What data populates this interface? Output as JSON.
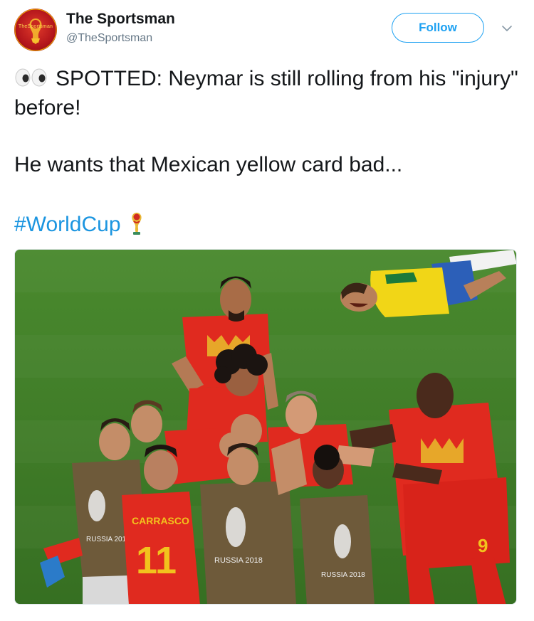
{
  "account": {
    "display_name": "The Sportsman",
    "handle": "@TheSportsman",
    "avatar_brand": "TheSportsman"
  },
  "actions": {
    "follow_label": "Follow"
  },
  "tweet": {
    "line1": "SPOTTED: Neymar is still rolling from his \"injury\" before!",
    "line2": "He wants that Mexican yellow card bad...",
    "hashtag": "#WorldCup"
  },
  "media": {
    "jersey_name": "CARRASCO",
    "jersey_number": "11",
    "striker_number": "9",
    "bib_text_1": "RUSSIA 2018",
    "bib_text_2": "RUSSIA 2018",
    "bib_text_3": "RUSSIA 2018"
  },
  "colors": {
    "accent": "#1da1f2",
    "hashtag": "#1b95e0",
    "text": "#14171a",
    "secondary": "#657786"
  },
  "icons": {
    "eyes": "eyes-emoji-icon",
    "world_cup": "world-cup-trophy-icon",
    "caret": "chevron-down-icon"
  }
}
